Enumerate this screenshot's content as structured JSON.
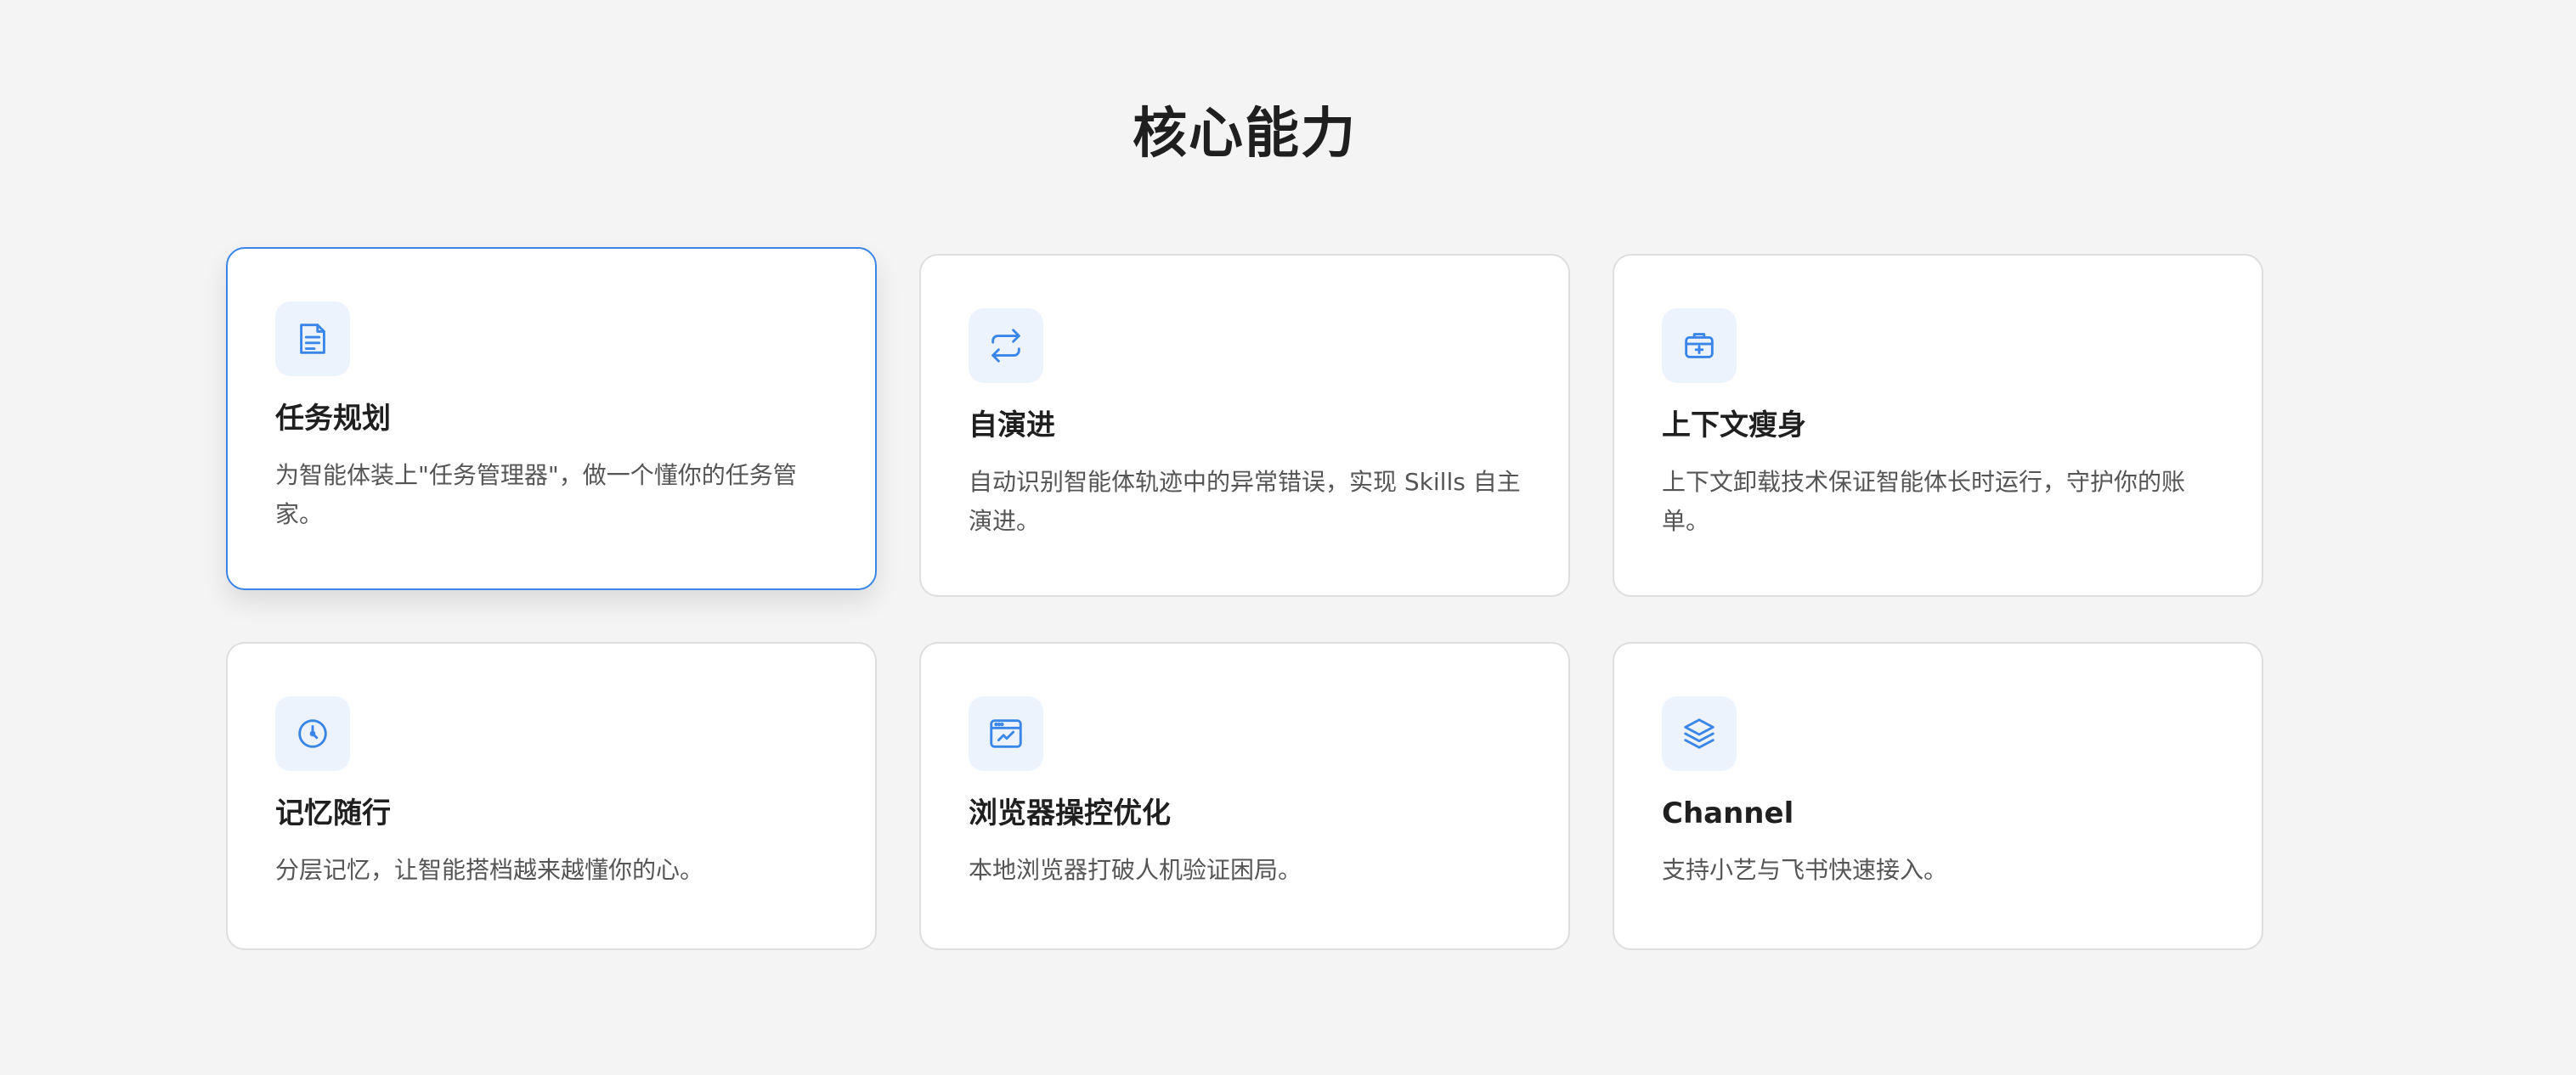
{
  "section": {
    "title": "核心能力"
  },
  "colors": {
    "accent": "#3a86e8",
    "icon_bg": "#edf3fd",
    "page_bg": "#f4f4f4",
    "card_border": "#dedede"
  },
  "cards": [
    {
      "icon": "task-list-icon",
      "title": "任务规划",
      "desc": "为智能体装上\"任务管理器\"，做一个懂你的任务管家。",
      "active": true
    },
    {
      "icon": "repeat-arrows-icon",
      "title": "自演进",
      "desc": "自动识别智能体轨迹中的异常错误，实现 Skills 自主演进。",
      "active": false
    },
    {
      "icon": "medical-kit-icon",
      "title": "上下文瘦身",
      "desc": "上下文卸载技术保证智能体长时运行，守护你的账单。",
      "active": false
    },
    {
      "icon": "compass-icon",
      "title": "记忆随行",
      "desc": "分层记忆，让智能搭档越来越懂你的心。",
      "active": false
    },
    {
      "icon": "browser-window-icon",
      "title": "浏览器操控优化",
      "desc": "本地浏览器打破人机验证困局。",
      "active": false
    },
    {
      "icon": "layers-icon",
      "title": "Channel",
      "desc": "支持小艺与飞书快速接入。",
      "active": false
    }
  ]
}
